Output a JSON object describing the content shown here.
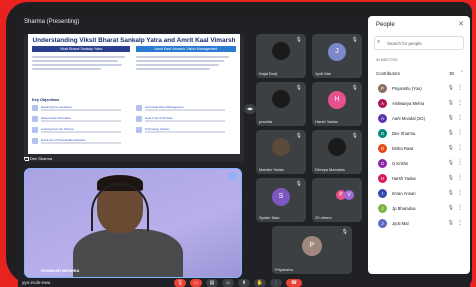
{
  "window": {
    "title": "Sharma (Presenting)"
  },
  "presentation": {
    "title": "Understanding Viksit Bharat Sankalp Yatra and Amrit Kaal Vimarsh",
    "col_left_head": "Viksit Bharat Sankalp Yatra",
    "col_right_head": "Amrit Kaal Vimarsh: Vision Management",
    "objectives_heading": "Key Objectives",
    "objectives": [
      "Reaching the unreached",
      "Disseminate information",
      "Learning from the Citizens",
      "Enrolment of Potential Beneficiaries",
      "Amrit Kaal Vision Management",
      "Goal of the Amrit Kaal",
      "Technology Infusion"
    ],
    "presenter_label": "Dev Sharma"
  },
  "self_view": {
    "name": "SHANKAR MESHRA"
  },
  "tiles": [
    {
      "name": "Kajal Dorji",
      "avatar": "",
      "type": "photo"
    },
    {
      "name": "Jyoti Mal",
      "avatar": "J",
      "color": "#7e87c9"
    },
    {
      "name": "pravida",
      "avatar": "",
      "type": "photo"
    },
    {
      "name": "Harsh Yadav",
      "avatar": "H",
      "color": "#e8518f"
    },
    {
      "name": "Manish Yadav",
      "avatar": "",
      "type": "photo"
    },
    {
      "name": "Dhreya Marvaria",
      "avatar": "",
      "type": "photo"
    },
    {
      "name": "Spider Man",
      "avatar": "S",
      "color": "#7d57c1"
    },
    {
      "name": "20 others",
      "avatar": "P",
      "color": "#e8518f"
    },
    {
      "name": "Priyanshu",
      "avatar": "P",
      "color": "#a1887f"
    }
  ],
  "people_panel": {
    "title": "People",
    "search_placeholder": "Search for people",
    "section": "IN MEETING",
    "contributors_label": "Contributors",
    "count": "30",
    "people": [
      {
        "name": "Priyanshu (You)",
        "color": "#8d6e63",
        "initial": "P"
      },
      {
        "name": "Aishwarya Mehra",
        "color": "#ad1457",
        "initial": "A"
      },
      {
        "name": "Aarti Mondal (2G)",
        "color": "#5e35b1",
        "initial": "A"
      },
      {
        "name": "Dev Sharma",
        "color": "#00897b",
        "initial": "D"
      },
      {
        "name": "Disha Rawt",
        "color": "#e64a19",
        "initial": "D"
      },
      {
        "name": "G Krishe",
        "color": "#8e24aa",
        "initial": "G"
      },
      {
        "name": "Harsh Yadav",
        "color": "#d81b60",
        "initial": "H"
      },
      {
        "name": "Imran Ansari",
        "color": "#3949ab",
        "initial": "I"
      },
      {
        "name": "Jp Bharadva",
        "color": "#7cb342",
        "initial": "J"
      },
      {
        "name": "Jyoti Mal",
        "color": "#5c6bc0",
        "initial": "J"
      }
    ]
  },
  "bottom": {
    "meeting_code": "yyo-zcde-nwu"
  },
  "icons": {
    "mic": "🎙",
    "more": "⋮",
    "close": "✕",
    "search": "🔍",
    "chevron": "⌃",
    "end_call": "☎",
    "camera": "▭",
    "raise_hand": "✋",
    "present": "⬆",
    "captions": "▤",
    "emoji": "☺"
  }
}
